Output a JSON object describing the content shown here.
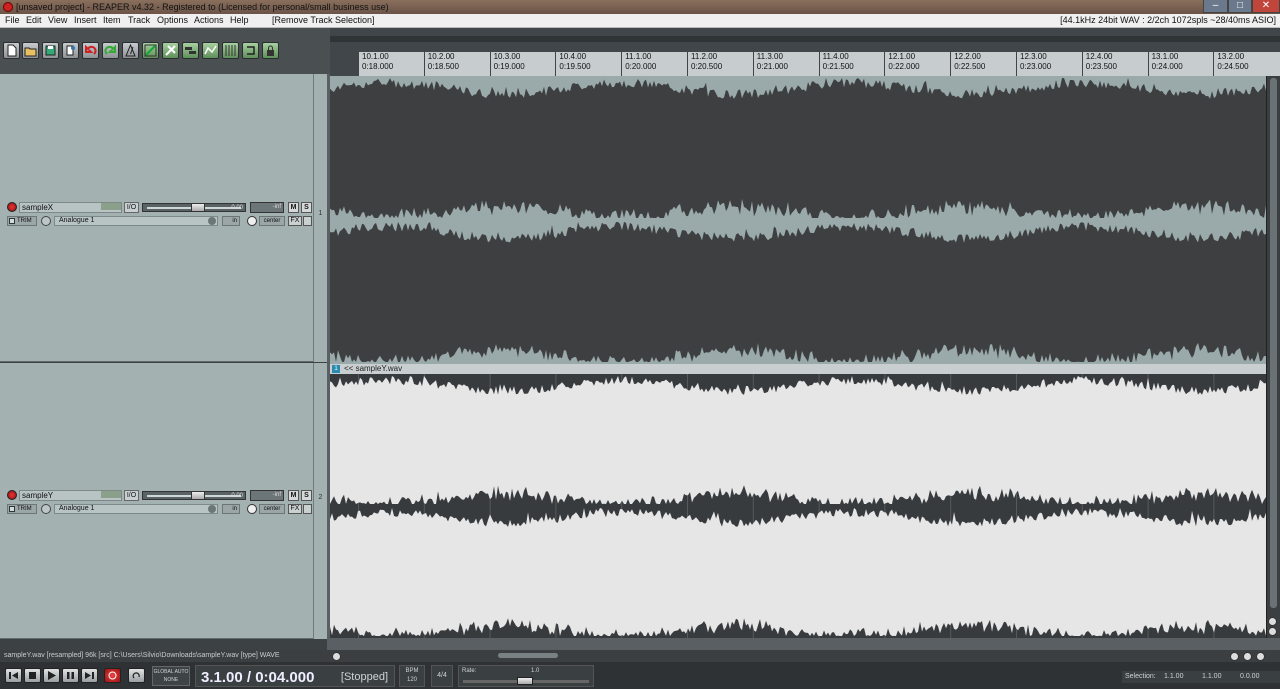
{
  "window": {
    "title": "[unsaved project] - REAPER v4.32 - Registered to    (Licensed for personal/small business use)",
    "minimize_icon": "minimize-icon",
    "maximize_icon": "maximize-icon",
    "close_icon": "close-icon"
  },
  "menu": {
    "items": [
      "File",
      "Edit",
      "View",
      "Insert",
      "Item",
      "Track",
      "Options",
      "Actions",
      "Help"
    ],
    "last_action": "[Remove Track Selection]",
    "audio_status": "[44.1kHz 24bit WAV : 2/2ch 1072spls ~28/40ms ASIO]"
  },
  "toolbar": {
    "icons": [
      "new-project-icon",
      "open-project-icon",
      "save-project-icon",
      "project-settings-icon",
      "undo-icon",
      "redo-icon",
      "metronome-icon",
      "grid-snap-icon",
      "ripple-edit-icon",
      "item-grouping-icon",
      "envelope-lock-icon",
      "grid-lines-icon",
      "loop-icon",
      "lock-icon"
    ]
  },
  "ruler": {
    "ticks": [
      {
        "measure": "10.1.00",
        "time": "0:18.000"
      },
      {
        "measure": "10.2.00",
        "time": "0:18.500"
      },
      {
        "measure": "10.3.00",
        "time": "0:19.000"
      },
      {
        "measure": "10.4.00",
        "time": "0:19.500"
      },
      {
        "measure": "11.1.00",
        "time": "0:20.000"
      },
      {
        "measure": "11.2.00",
        "time": "0:20.500"
      },
      {
        "measure": "11.3.00",
        "time": "0:21.000"
      },
      {
        "measure": "11.4.00",
        "time": "0:21.500"
      },
      {
        "measure": "12.1.00",
        "time": "0:22.000"
      },
      {
        "measure": "12.2.00",
        "time": "0:22.500"
      },
      {
        "measure": "12.3.00",
        "time": "0:23.000"
      },
      {
        "measure": "12.4.00",
        "time": "0:23.500"
      },
      {
        "measure": "13.1.00",
        "time": "0:24.000"
      },
      {
        "measure": "13.2.00",
        "time": "0:24.500"
      }
    ]
  },
  "tracks": [
    {
      "number": "1",
      "name": "sampleX",
      "io_label": "I/O",
      "volume": "0.00",
      "peak": "-inf",
      "mute": "M",
      "solo": "S",
      "trim": "TRIM",
      "input": "Analogue 1",
      "in_label": "in",
      "pan": "center",
      "fx": "FX"
    },
    {
      "number": "2",
      "name": "sampleY",
      "io_label": "I/O",
      "volume": "0.00",
      "peak": "-inf",
      "mute": "M",
      "solo": "S",
      "trim": "TRIM",
      "input": "Analogue 1",
      "in_label": "in",
      "pan": "center",
      "fx": "FX"
    }
  ],
  "item": {
    "number": "1",
    "name": "<< sampleY.wav"
  },
  "status_line": "sampleY.wav [resampled] 96k [src] C:\\Users\\Silvio\\Downloads\\sampleY.wav [type] WAVE",
  "transport": {
    "time": "3.1.00 / 0:04.000",
    "state": "[Stopped]",
    "global_auto_1": "GLOBAL AUTO",
    "global_auto_2": "NONE",
    "bpm_label": "BPM",
    "bpm_value": "120",
    "time_sig": "4/4",
    "rate_label": "Rate:",
    "rate_value": "1.0",
    "selection_label": "Selection:",
    "sel_start": "1.1.00",
    "sel_end": "1.1.00",
    "sel_length": "0.0.00"
  },
  "colors": {
    "track1_peak": "#3d3f41",
    "track1_bg": "#9aa9aa",
    "track2_peak": "#e6e6e6",
    "track2_bg": "#383b3e"
  }
}
